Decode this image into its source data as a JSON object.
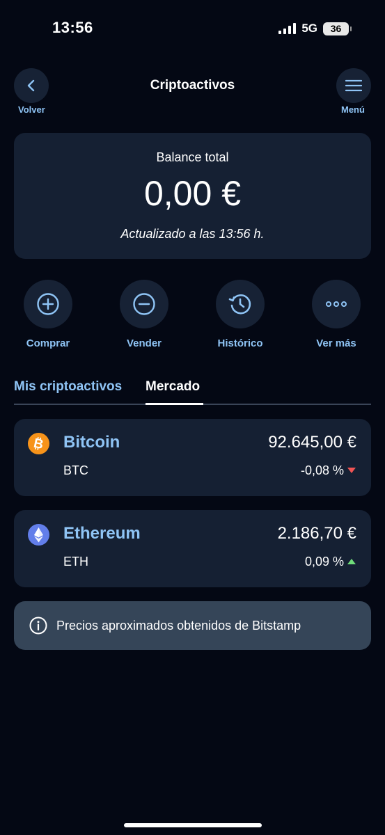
{
  "status_bar": {
    "time": "13:56",
    "network": "5G",
    "battery": "36"
  },
  "header": {
    "title": "Criptoactivos",
    "back_label": "Volver",
    "menu_label": "Menú"
  },
  "balance": {
    "label": "Balance total",
    "value": "0,00 €",
    "updated": "Actualizado a las 13:56 h."
  },
  "actions": [
    {
      "label": "Comprar",
      "icon": "plus-circle-icon"
    },
    {
      "label": "Vender",
      "icon": "minus-circle-icon"
    },
    {
      "label": "Histórico",
      "icon": "history-icon"
    },
    {
      "label": "Ver más",
      "icon": "more-dots-icon"
    }
  ],
  "tabs": [
    {
      "label": "Mis criptoactivos",
      "active": false
    },
    {
      "label": "Mercado",
      "active": true
    }
  ],
  "coins": [
    {
      "name": "Bitcoin",
      "symbol": "BTC",
      "price": "92.645,00 €",
      "change": "-0,08 %",
      "direction": "down",
      "icon": "bitcoin-icon",
      "icon_color": "#f7931a"
    },
    {
      "name": "Ethereum",
      "symbol": "ETH",
      "price": "2.186,70 €",
      "change": "0,09 %",
      "direction": "up",
      "icon": "ethereum-icon",
      "icon_color": "#627eea"
    }
  ],
  "info": {
    "text": "Precios aproximados obtenidos de Bitstamp",
    "icon": "info-icon"
  },
  "colors": {
    "background": "#040814",
    "card": "#152033",
    "accent": "#8fc4f5",
    "down": "#f05454",
    "up": "#6fdc7a",
    "banner": "#354558"
  }
}
